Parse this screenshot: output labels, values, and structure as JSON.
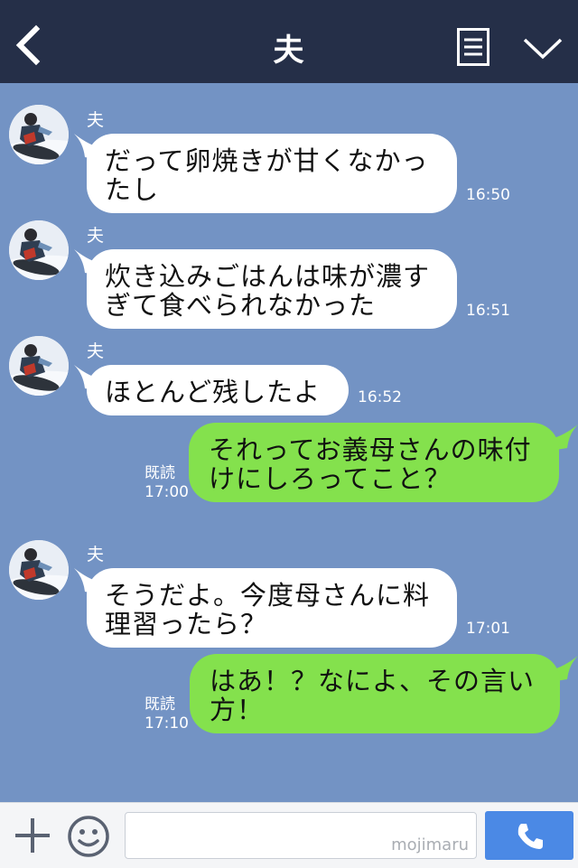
{
  "header": {
    "title": "夫",
    "back_icon": "chevron-left-icon",
    "menu_icon": "list-menu-icon",
    "expand_icon": "chevron-down-icon"
  },
  "messages": [
    {
      "side": "left",
      "sender": "夫",
      "text": "だって卵焼きが甘くなかったし",
      "lines": [
        "だって卵焼きが甘くなかっ",
        "たし"
      ],
      "time": "16:50"
    },
    {
      "side": "left",
      "sender": "夫",
      "text": "炊き込みごはんは味が濃すぎて食べられなかった",
      "lines": [
        "炊き込みごはんは味が濃す",
        "ぎて食べられなかった"
      ],
      "time": "16:51"
    },
    {
      "side": "left",
      "sender": "夫",
      "text": "ほとんど残したよ",
      "lines": [
        "ほとんど残したよ"
      ],
      "time": "16:52"
    },
    {
      "side": "right",
      "text": "それってお義母さんの味付けにしろってこと？",
      "lines": [
        "それってお義母さんの味付",
        "けにしろってこと？"
      ],
      "read": "既読",
      "time": "17:00"
    },
    {
      "side": "left",
      "sender": "夫",
      "text": "そうだよ。今度母さんに料理習ったら？",
      "lines": [
        "そうだよ。今度母さんに料",
        "理習ったら？"
      ],
      "time": "17:01"
    },
    {
      "side": "right",
      "text": "はあ！？なによ、その言い方！",
      "lines": [
        "はあ！？なによ、その言い",
        "方！"
      ],
      "read": "既読",
      "time": "17:10"
    }
  ],
  "input": {
    "placeholder": "",
    "watermark": "mojimaru",
    "plus_icon": "plus-icon",
    "sticker_icon": "smiley-icon",
    "call_icon": "phone-icon"
  },
  "colors": {
    "header": "#252f48",
    "background": "#7393c4",
    "my_bubble": "#84e14d",
    "their_bubble": "#ffffff",
    "call_button": "#4b89e5"
  }
}
